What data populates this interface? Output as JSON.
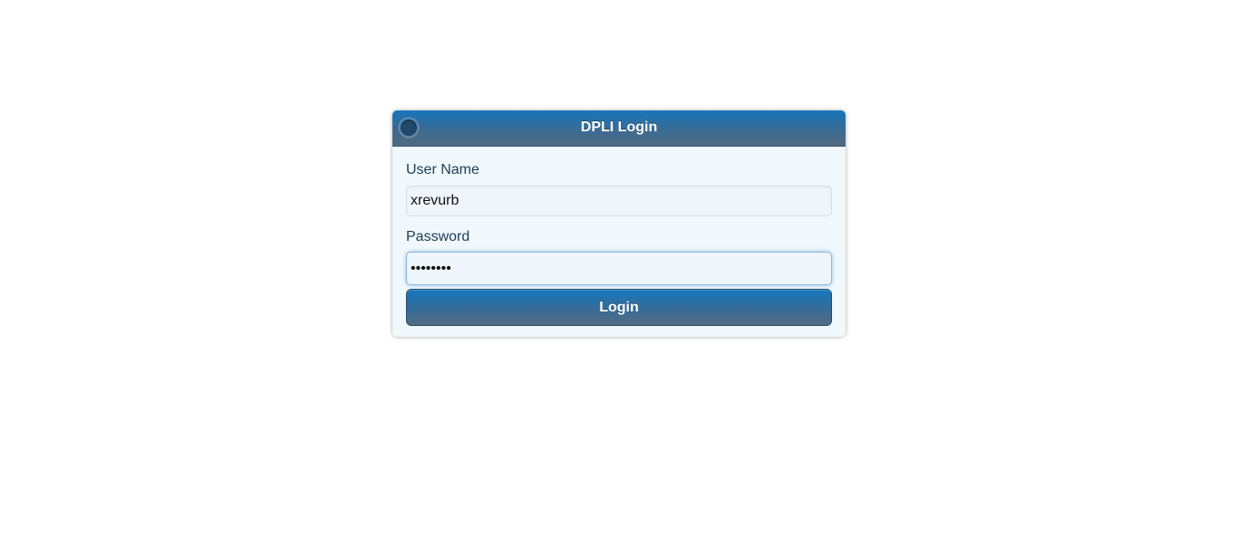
{
  "dialog": {
    "title": "DPLI Login",
    "close_icon": "close-circle-icon"
  },
  "form": {
    "username_label": "User Name",
    "username_value": "xrevurb",
    "password_label": "Password",
    "password_value": "••••••••",
    "login_label": "Login"
  },
  "colors": {
    "header_top": "#1577bd",
    "header_bottom": "#506a80",
    "dialog_bg": "#f0f8fc",
    "label_text": "#1c3d55"
  }
}
